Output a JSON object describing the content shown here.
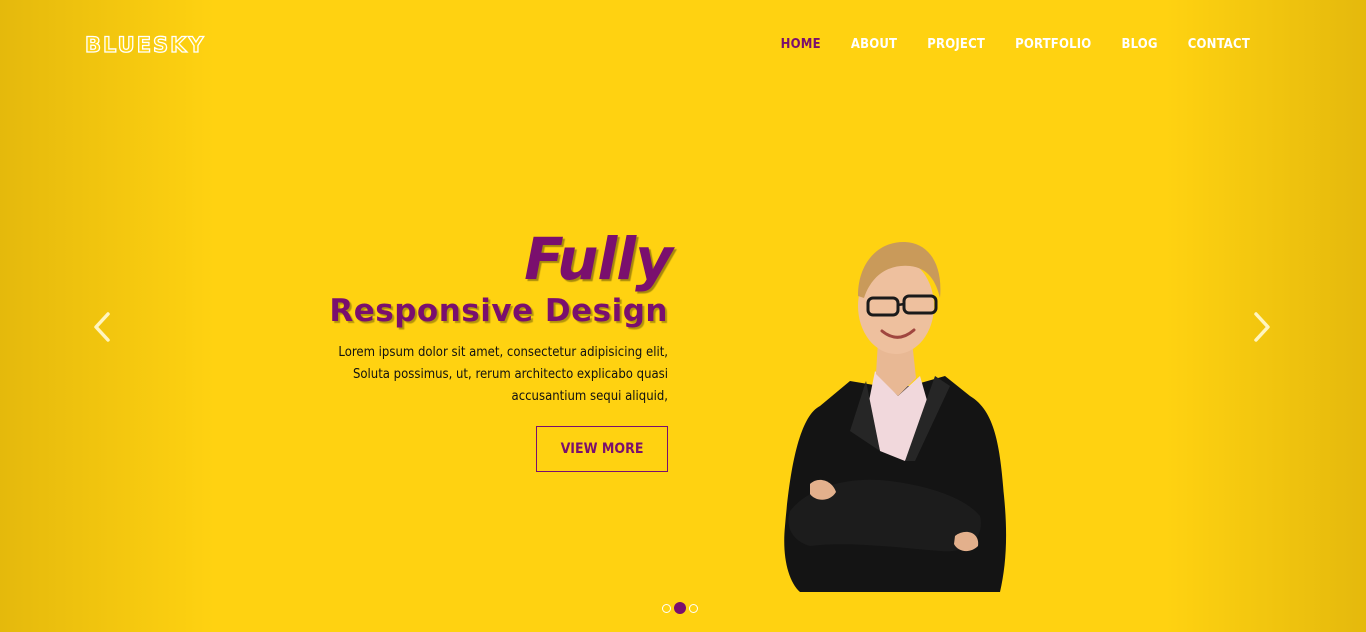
{
  "brand": {
    "logo_text": "BLUESKY"
  },
  "nav": {
    "items": [
      {
        "label": "HOME",
        "active": true
      },
      {
        "label": "ABOUT",
        "active": false
      },
      {
        "label": "PROJECT",
        "active": false
      },
      {
        "label": "PORTFOLIO",
        "active": false
      },
      {
        "label": "BLOG",
        "active": false
      },
      {
        "label": "CONTACT",
        "active": false
      }
    ]
  },
  "slide": {
    "title_main": "Fully",
    "title_sub": "Responsive Design",
    "description": "Lorem ipsum dolor sit amet, consectetur adipisicing elit, Soluta possimus, ut, rerum architecto explicabo quasi accusantium sequi aliquid,",
    "button_label": "VIEW MORE"
  },
  "carousel": {
    "slide_count": 3,
    "active_index": 1,
    "prev_icon": "chevron-left-icon",
    "next_icon": "chevron-right-icon"
  },
  "colors": {
    "background": "#ffd211",
    "accent": "#7a0f6e",
    "nav_text": "#ffffff",
    "body_text": "#111111"
  }
}
